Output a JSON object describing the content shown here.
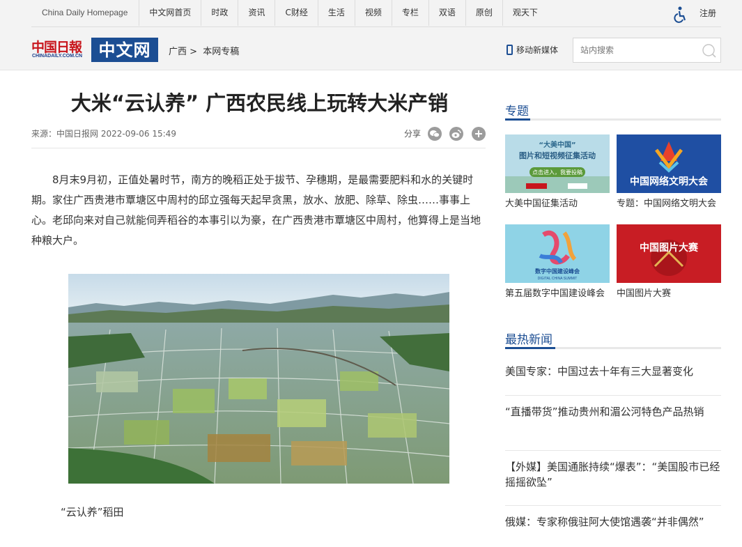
{
  "nav": {
    "homepage": "China Daily Homepage",
    "items": [
      "中文网首页",
      "时政",
      "资讯",
      "C财经",
      "生活",
      "视频",
      "专栏",
      "双语",
      "原创",
      "观天下"
    ],
    "register": "注册"
  },
  "logo": {
    "brand_cn": "中国日報",
    "brand_en": "CHINADAILY.COM.CN",
    "site": "中文网"
  },
  "breadcrumb": [
    "广西",
    ">",
    "本网专稿"
  ],
  "header": {
    "mobile_label": "移动新媒体",
    "search_placeholder": "站内搜索"
  },
  "article": {
    "title": "大米“云认养” 广西农民线上玩转大米产销",
    "source": "来源：中国日报网 2022-09-06 15:49",
    "share_label": "分享",
    "paragraph": "8月末9月初，正值处暑时节，南方的晚稻正处于拔节、孕穗期，是最需要肥料和水的关键时期。家住广西贵港市覃塘区中周村的邱立强每天起早贪黑，放水、放肥、除草、除虫……事事上心。老邱向来对自己就能伺弄稻谷的本事引以为豪，在广西贵港市覃塘区中周村，他算得上是当地种粮大户。",
    "caption": "“云认养”稻田"
  },
  "sidebar": {
    "topics_heading": "专题",
    "topics": [
      {
        "caption": "大美中国征集活动",
        "img_line1": "“大美中国”",
        "img_line2": "图片和短视频征集活动",
        "img_button": "点击进入，我要投稿"
      },
      {
        "caption": "专题：中国网络文明大会",
        "img_text": "中国网络文明大会"
      },
      {
        "caption": "第五届数字中国建设峰会",
        "img_text": "数字中国建设峰会",
        "img_sub": "DIGITAL CHINA SUMMIT"
      },
      {
        "caption": "中国图片大赛",
        "img_text": "中国图片大赛"
      }
    ],
    "hot_heading": "最热新闻",
    "hot": [
      "美国专家：中国过去十年有三大显著变化",
      "“直播带货”推动贵州和湄公河特色产品热销",
      "【外媒】美国通胀持续“爆表”：“美国股市已经摇摇欲坠”",
      "俄媒：专家称俄驻阿大使馆遇袭“并非偶然”"
    ]
  },
  "colors": {
    "brand_blue": "#1c4e93",
    "brand_red": "#c8161d"
  }
}
